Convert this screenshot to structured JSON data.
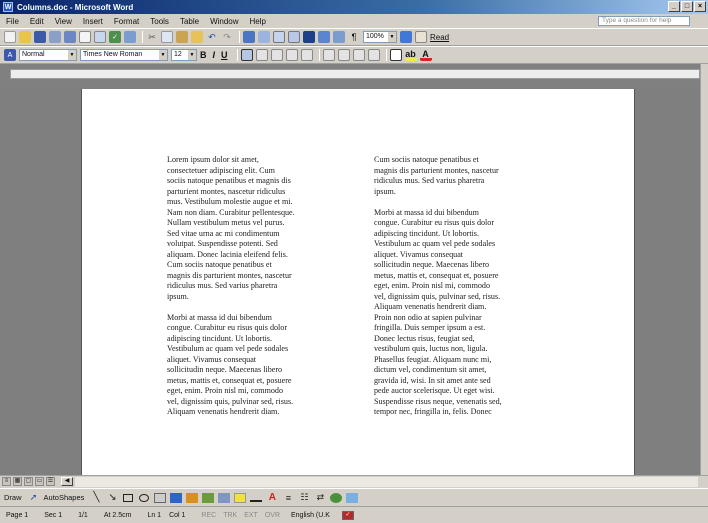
{
  "window": {
    "title": "Columns.doc - Microsoft Word"
  },
  "menu": [
    "File",
    "Edit",
    "View",
    "Insert",
    "Format",
    "Tools",
    "Table",
    "Window",
    "Help"
  ],
  "help_box": {
    "placeholder": "Type a question for help"
  },
  "toolbar": {
    "zoom": "100%",
    "read_label": "Read"
  },
  "formatting": {
    "style": "Normal",
    "font": "Times New Roman",
    "size": "12",
    "bold": "B",
    "italic": "I",
    "underline": "U"
  },
  "document": {
    "column1": "Lorem ipsum dolor sit amet,\nconsectetuer adipiscing elit. Cum\nsociis natoque penatibus et magnis dis\nparturient montes, nascetur ridiculus\nmus. Vestibulum molestie augue et mi.\nNam non diam. Curabitur pellentesque.\nNullam vestibulum metus vel purus.\nSed vitae urna ac mi condimentum\nvolutpat. Suspendisse potenti. Sed\naliquam. Donec lacinia eleifend felis.\nCum sociis natoque penatibus et\nmagnis dis parturient montes, nascetur\nridiculus mus. Sed varius pharetra\nipsum.\n\nMorbi at massa id dui bibendum\ncongue. Curabitur eu risus quis dolor\nadipiscing tincidunt. Ut lobortis.\nVestibulum ac quam vel pede sodales\naliquet. Vivamus consequat\nsollicitudin neque. Maecenas libero\nmetus, mattis et, consequat et, posuere\neget, enim. Proin nisl mi, commodo\nvel, dignissim quis, pulvinar sed, risus.\nAliquam venenatis hendrerit diam.",
    "column2": "Cum sociis natoque penatibus et\nmagnis dis parturient montes, nascetur\nridiculus mus. Sed varius pharetra\nipsum.\n\nMorbi at massa id dui bibendum\ncongue. Curabitur eu risus quis dolor\nadipiscing tincidunt. Ut lobortis.\nVestibulum ac quam vel pede sodales\naliquet. Vivamus consequat\nsollicitudin neque. Maecenas libero\nmetus, mattis et, consequat et, posuere\neget, enim. Proin nisl mi, commodo\nvel, dignissim quis, pulvinar sed, risus.\nAliquam venenatis hendrerit diam.\nProin non odio at sapien pulvinar\nfringilla. Duis semper ipsum a est.\nDonec lectus risus, feugiat sed,\nvestibulum quis, luctus non, ligula.\nPhasellus feugiat. Aliquam nunc mi,\ndictum vel, condimentum sit amet,\ngravida id, wisi. In sit amet ante sed\npede auctor scelerisque. Ut eget wisi.\nSuspendisse risus neque, venenatis sed,\ntempor nec, fringilla in, felis. Donec"
  },
  "drawing": {
    "draw_label": "Draw",
    "autoshapes_label": "AutoShapes"
  },
  "status": {
    "page": "Page 1",
    "section": "Sec 1",
    "pages": "1/1",
    "at": "At 2.5cm",
    "line": "Ln 1",
    "col": "Col 1",
    "rec": "REC",
    "trk": "TRK",
    "ext": "EXT",
    "ovr": "OVR",
    "language": "English (U.K"
  }
}
